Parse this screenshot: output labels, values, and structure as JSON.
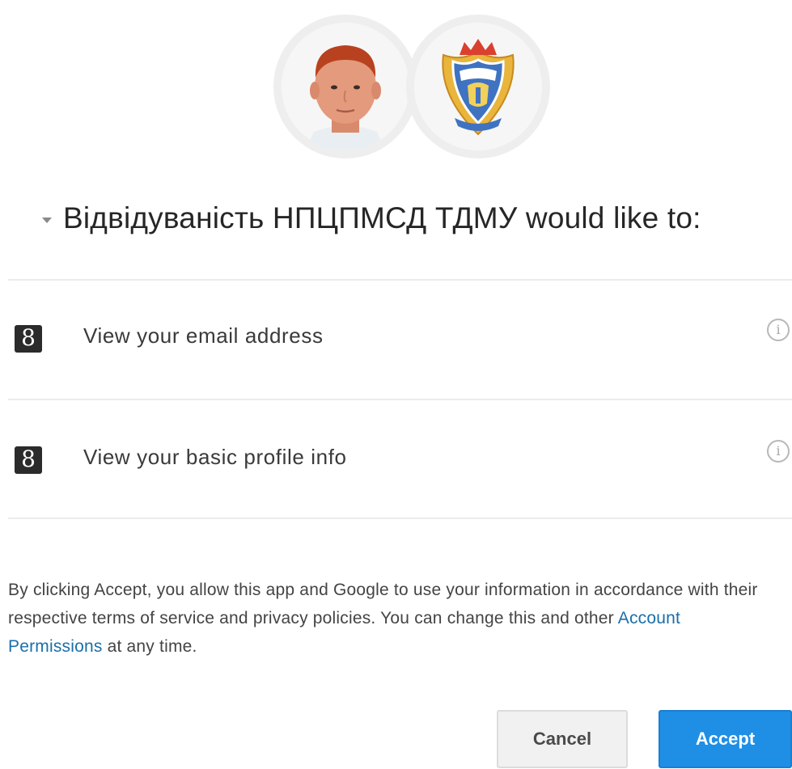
{
  "app_name": "Відвідуваність НПЦПМСД ТДМУ",
  "heading": {
    "text": "Відвідуваність НПЦПМСД ТДМУ would like to:"
  },
  "avatars": {
    "user_icon": "user-photo",
    "app_icon": "app-logo-crest"
  },
  "scopes": [
    {
      "icon": "google-plus-g-icon",
      "icon_glyph": "8",
      "label": "View your email address",
      "info_icon": "info-icon",
      "info_glyph": "i"
    },
    {
      "icon": "google-plus-g-icon",
      "icon_glyph": "8",
      "label": "View your basic profile info",
      "info_icon": "info-icon",
      "info_glyph": "i"
    }
  ],
  "disclaimer": {
    "before_link": "By clicking Accept, you allow this app and Google to use your information in accordance with their respective terms of service and privacy policies. You can change this and other ",
    "link_text": "Account Permissions",
    "after_link": " at any time."
  },
  "buttons": {
    "cancel_label": "Cancel",
    "accept_label": "Accept"
  },
  "colors": {
    "accept_bg": "#1f8fe6",
    "link": "#1a6fa8",
    "divider": "#ececec"
  }
}
